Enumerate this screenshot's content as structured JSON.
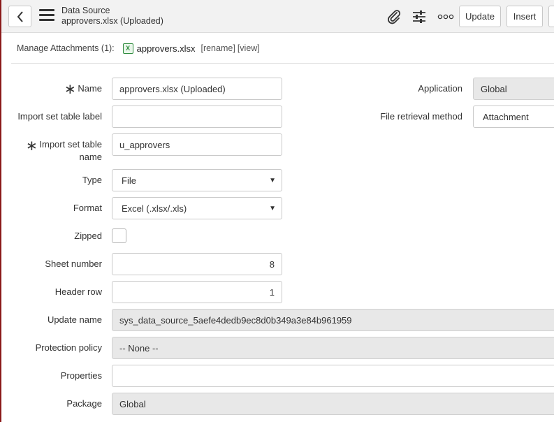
{
  "header": {
    "title": "Data Source",
    "subtitle": "approvers.xlsx (Uploaded)",
    "update_label": "Update",
    "insert_label": "Insert",
    "icons": [
      "back-icon",
      "menu-icon",
      "paperclip-icon",
      "sliders-icon",
      "more-icon"
    ]
  },
  "attachments": {
    "label": "Manage Attachments (1):",
    "file_name": "approvers.xlsx",
    "rename_label": "[rename]",
    "view_label": "[view]"
  },
  "form": {
    "name": {
      "label": "Name",
      "value": "approvers.xlsx (Uploaded)"
    },
    "import_set_label": {
      "label": "Import set table label",
      "value": ""
    },
    "import_set_name": {
      "label_line1": "Import set table",
      "label_line2": "name",
      "value": "u_approvers"
    },
    "type": {
      "label": "Type",
      "value": "File"
    },
    "format": {
      "label": "Format",
      "value": "Excel (.xlsx/.xls)"
    },
    "zipped": {
      "label": "Zipped",
      "checked": false
    },
    "sheet_number": {
      "label": "Sheet number",
      "value": "8"
    },
    "header_row": {
      "label": "Header row",
      "value": "1"
    },
    "update_name": {
      "label": "Update name",
      "value": "sys_data_source_5aefe4dedb9ec8d0b349a3e84b961959"
    },
    "protection_policy": {
      "label": "Protection policy",
      "value": "-- None --"
    },
    "properties": {
      "label": "Properties",
      "value": ""
    },
    "package": {
      "label": "Package",
      "value": "Global"
    },
    "application": {
      "label": "Application",
      "value": "Global"
    },
    "file_retrieval": {
      "label": "File retrieval method",
      "value": "Attachment"
    }
  },
  "required_marker": "∗"
}
